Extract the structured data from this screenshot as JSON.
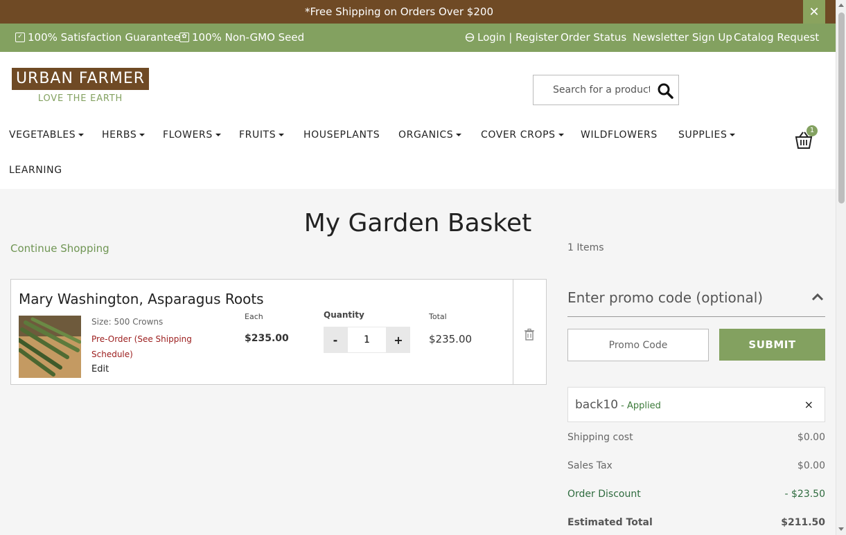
{
  "topbar": {
    "message": "*Free Shipping on Orders Over $200",
    "close_label": "✕"
  },
  "utility": {
    "satisfaction": "100% Satisfaction Guarantee",
    "non_gmo": "100% Non-GMO Seed",
    "login": "Login | Register",
    "order_status": "Order Status",
    "newsletter": "Newsletter Sign Up",
    "catalog": "Catalog Request"
  },
  "logo": {
    "name": "URBAN FARMER",
    "tagline": "LOVE THE EARTH"
  },
  "search": {
    "placeholder": "Search for a product"
  },
  "nav": {
    "vegetables": "VEGETABLES",
    "herbs": "HERBS",
    "flowers": "FLOWERS",
    "fruits": "FRUITS",
    "houseplants": "HOUSEPLANTS",
    "organics": "ORGANICS",
    "cover_crops": "COVER CROPS",
    "wildflowers": "WILDFLOWERS",
    "supplies": "SUPPLIES",
    "learning": "LEARNING"
  },
  "cart": {
    "count": "1"
  },
  "page": {
    "title": "My Garden Basket",
    "continue": "Continue Shopping",
    "items_count": "1 Items"
  },
  "item": {
    "name": "Mary Washington, Asparagus Roots",
    "size": "Size: 500 Crowns",
    "preorder": "Pre-Order (See Shipping Schedule)",
    "edit": "Edit",
    "each_label": "Each",
    "each_price": "$235.00",
    "qty_label": "Quantity",
    "qty_value": "1",
    "minus": "-",
    "plus": "+",
    "total_label": "Total",
    "total_price": "$235.00"
  },
  "promo": {
    "heading": "Enter promo code (optional)",
    "placeholder": "Promo Code",
    "submit": "SUBMIT",
    "applied_code": "back10",
    "applied_status": " - Applied",
    "remove": "×"
  },
  "summary": {
    "shipping_label": "Shipping cost",
    "shipping_value": "$0.00",
    "tax_label": "Sales Tax",
    "tax_value": "$0.00",
    "discount_label": "Order Discount",
    "discount_value": "- $23.50",
    "total_label": "Estimated Total",
    "total_value": "$211.50"
  },
  "colors": {
    "brown": "#6f4a25",
    "green": "#83a160",
    "preorder_red": "#9b1c1c"
  }
}
